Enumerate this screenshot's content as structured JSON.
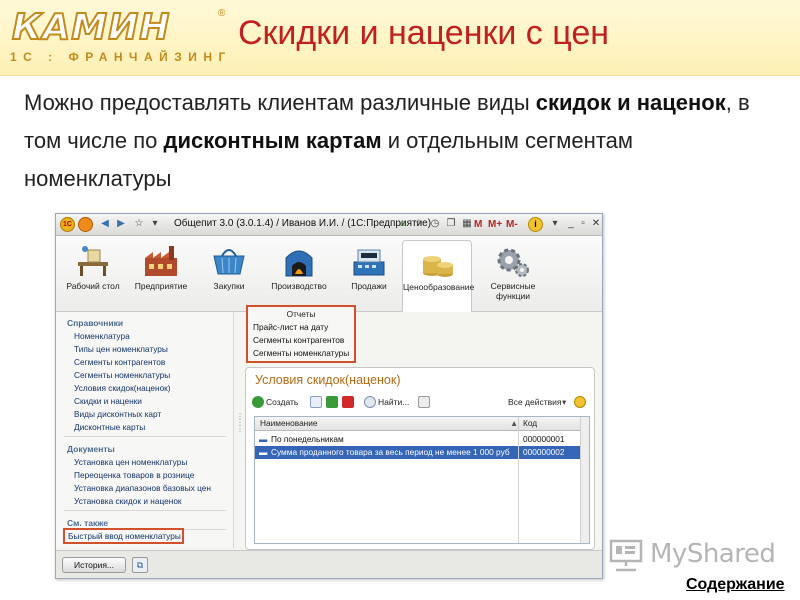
{
  "slide": {
    "logo": {
      "word": "КАМИН",
      "sub": "1С : ФРАНЧАЙЗИНГ",
      "reg": "®"
    },
    "title": "Скидки и наценки с цен",
    "text": {
      "p1": "Можно предоставлять клиентам различные виды ",
      "b1": "скидок и наценок",
      "p2": ", в том числе по ",
      "b2": "дисконтным картам",
      "p3": " и отдельным сегментам номенклатуры"
    },
    "footer": {
      "watermark": "MyShared",
      "contents_link": "Содержание"
    }
  },
  "window": {
    "title": "Общепит 3.0 (3.0.1.4) / Иванов И.И. /  (1С:Предприятие)",
    "toolbar_right": [
      "M",
      "M+",
      "M-",
      "i"
    ],
    "sections": [
      {
        "label": "Рабочий стол",
        "icon": "desk-icon"
      },
      {
        "label": "Предприятие",
        "icon": "factory-icon"
      },
      {
        "label": "Закупки",
        "icon": "basket-icon"
      },
      {
        "label": "Производство",
        "icon": "oven-icon"
      },
      {
        "label": "Продажи",
        "icon": "cash-register-icon"
      },
      {
        "label": "Ценообразование",
        "icon": "coins-icon"
      },
      {
        "label": "Сервисные функции",
        "icon": "gears-icon"
      }
    ],
    "active_section": "Ценообразование",
    "left_panel": {
      "groups": [
        {
          "title": "Справочники",
          "items": [
            "Номенклатура",
            "Типы цен номенклатуры",
            "Сегменты контрагентов",
            "Сегменты номенклатуры",
            "Условия скидок(наценок)",
            "Скидки и наценки",
            "Виды дисконтных карт",
            "Дисконтные карты"
          ]
        },
        {
          "title": "Документы",
          "items": [
            "Установка цен номенклатуры",
            "Переоценка товаров в рознице",
            "Установка диапазонов базовых цен",
            "Установка скидок и наценок"
          ]
        },
        {
          "title": "См. также",
          "items": [
            "Быстрый ввод номенклатуры"
          ]
        }
      ]
    },
    "reports": {
      "title": "Отчеты",
      "items": [
        "Прайс-лист на дату",
        "Сегменты контрагентов",
        "Сегменты номенклатуры"
      ]
    },
    "form": {
      "title": "Условия скидок(наценок)",
      "toolbar": {
        "create": "Создать",
        "find": "Найти...",
        "all_actions": "Все действия"
      },
      "columns": {
        "name": "Наименование",
        "code": "Код"
      },
      "rows": [
        {
          "name": "По понедельникам",
          "code": "000000001",
          "selected": false
        },
        {
          "name": "Сумма проданного товара  за весь период не менее 1 000 руб",
          "code": "000000002",
          "selected": true
        }
      ]
    },
    "statusbar": {
      "history": "История..."
    }
  },
  "colors": {
    "title_red": "#c21f1f",
    "highlight_frame": "#d2502a",
    "form_title": "#b76a12",
    "selection": "#3565b7"
  }
}
